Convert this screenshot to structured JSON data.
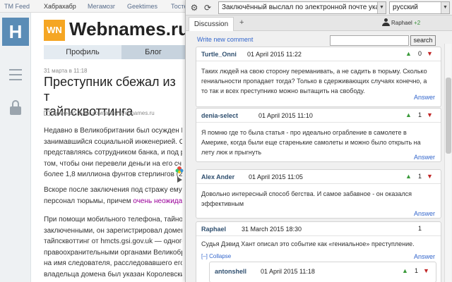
{
  "topnav": {
    "items": [
      "TM Feed",
      "Хабрахабр",
      "Мегамозг",
      "Geektimes",
      "Тостер"
    ]
  },
  "left_rail": {
    "logo_letter": "H"
  },
  "article": {
    "brand_logo_text": "WN",
    "brand_name": "Webnames.ru",
    "tabs": [
      "Профиль",
      "Блог"
    ],
    "date": "31 марта в 11:18",
    "title_line1": "Преступник сбежал из т",
    "title_line2": "тайпсквоттинга",
    "hubs": "Домены*, Блог компании Webnames.ru",
    "p1": [
      "Недавно в Великобритании был осужден Н",
      "занимавшийся социальной инженерией. Он",
      "представляясь сотрудником банка, и под р",
      "том, чтобы они перевели деньги на его сч",
      "более 1,8 миллиона фунтов стерлингов (2"
    ],
    "p2_line1": "Вскоре после заключения под стражу ему у",
    "p2_line2_before": "персонал тюрьмы, причем ",
    "p2_line2_link": "очень неожидан",
    "p3": [
      "При помощи мобильного телефона, тайно п",
      "заключенными, он зарегистрировал домен",
      "тайпсквоттинг от hmcts.gsi.gov.uk — одного",
      "правоохранительными органами Великобри",
      "на имя следователя, расследовавшего его",
      "владельца домена был указан Королевский"
    ]
  },
  "panel": {
    "page_select": "Заключённый выслал по электронной почте указани...",
    "language": "русский",
    "tab_discussion": "Discussion",
    "tab_add": "+",
    "user": "Raphael",
    "user_extra": "+2",
    "write_comment": "Write new comment",
    "search_button": "search",
    "search_value": "",
    "answer_label": "Answer",
    "collapse_label": "[–] Collapse",
    "comments": [
      {
        "author": "Turtle_Onni",
        "date": "01 April 2015 11:22",
        "score": "0",
        "body": "Таких людей на свою сторону переманивать, а не садить в тюрьму. Сколько гениальности пропадает тогда? Только в сдерживающих случаях конечно, а то так и всех преступнико можно вытащить на свободу."
      },
      {
        "author": "denia-select",
        "date": "01 April 2015 11:10",
        "score": "1",
        "body": "Я помню где то была статья - про идеально ограбление в самолете в Америке, когда были еще старенькие самолеты и можно было открыть на лету люк и прыгнуть"
      },
      {
        "author": "Alex Ander",
        "date": "01 April 2015 11:05",
        "score": "1",
        "body": "Довольно интересный способ бегства. И самое забавное - он оказался эффективным"
      },
      {
        "author": "Raphael",
        "date": "31 March 2015 18:30",
        "score": "1",
        "body": "Судья Дэвид Хант описал это событие как «гениальное» преступление."
      },
      {
        "author": "antonshell",
        "date": "01 April 2015 11:18",
        "score": "1",
        "body": ""
      }
    ]
  },
  "colors": {
    "accent_blue": "#5a8cb6",
    "brand_orange": "#f5a623",
    "upvote_green": "#3a9a3a",
    "downvote_red": "#c02525",
    "link_blue": "#3366cc"
  }
}
